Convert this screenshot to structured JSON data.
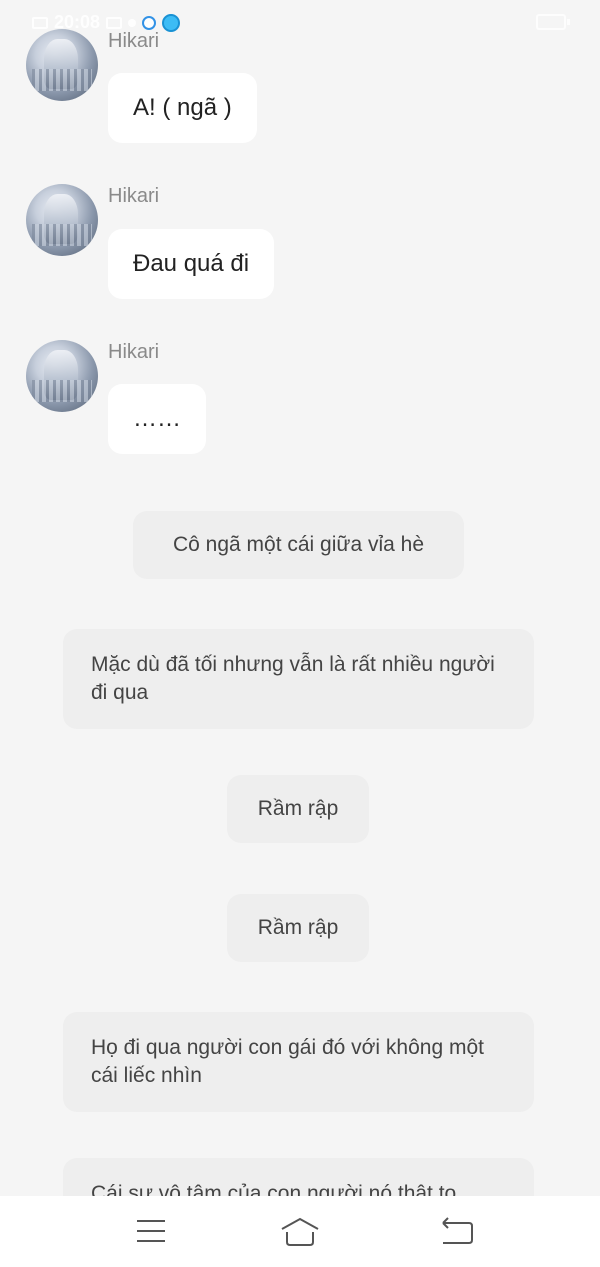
{
  "status_bar": {
    "time": "20:08"
  },
  "messages": [
    {
      "sender": "Hikari",
      "text": "A! ( ngã )"
    },
    {
      "sender": "Hikari",
      "text": "Đau quá đi"
    },
    {
      "sender": "Hikari",
      "text": "……"
    }
  ],
  "narration": [
    "Cô ngã một cái giữa vỉa hè",
    "Mặc dù đã tối nhưng vẫn là rất nhiều người đi qua",
    "Rầm rập",
    "Rầm rập",
    "Họ đi qua người con gái đó với không một cái liếc nhìn",
    "Cái sự vô tâm của con người nó thật to"
  ],
  "nav": {
    "menu_icon": "menu-icon",
    "home_icon": "home-icon",
    "back_icon": "back-icon"
  }
}
